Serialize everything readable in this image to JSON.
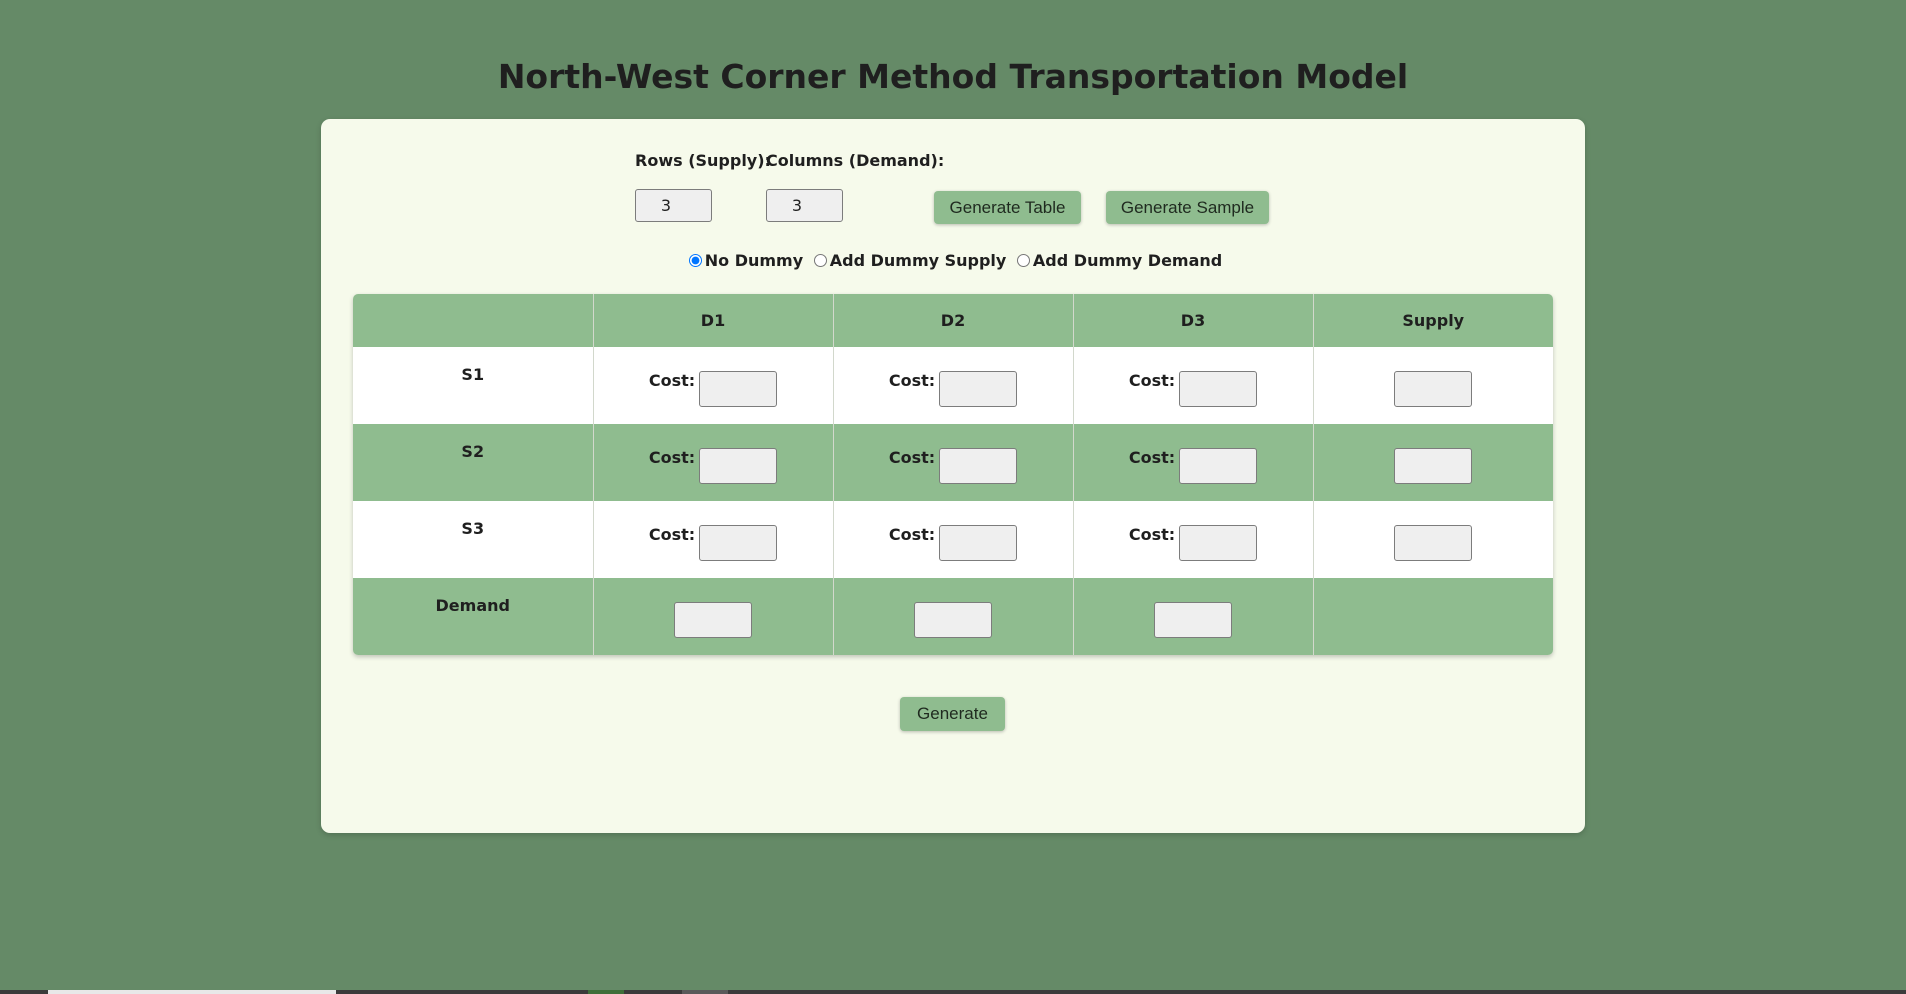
{
  "page": {
    "title": "North-West Corner Method Transportation Model"
  },
  "controls": {
    "rows_label": "Rows (Supply):",
    "rows_value": "3",
    "cols_label": "Columns (Demand):",
    "cols_value": "3",
    "generate_table_label": "Generate Table",
    "generate_sample_label": "Generate Sample"
  },
  "dummy_options": {
    "selected": "no-dummy",
    "options": [
      {
        "id": "no-dummy",
        "label": "No Dummy",
        "checked": true
      },
      {
        "id": "add-dummy-supply",
        "label": "Add Dummy Supply",
        "checked": false
      },
      {
        "id": "add-dummy-demand",
        "label": "Add Dummy Demand",
        "checked": false
      }
    ]
  },
  "table": {
    "corner": "",
    "headers": [
      "D1",
      "D2",
      "D3",
      "Supply"
    ],
    "cost_label": "Cost:",
    "rows": [
      {
        "label": "S1",
        "costs": [
          "",
          "",
          ""
        ],
        "supply": ""
      },
      {
        "label": "S2",
        "costs": [
          "",
          "",
          ""
        ],
        "supply": ""
      },
      {
        "label": "S3",
        "costs": [
          "",
          "",
          ""
        ],
        "supply": ""
      }
    ],
    "demand_row": {
      "label": "Demand",
      "values": [
        "",
        "",
        ""
      ]
    }
  },
  "actions": {
    "generate_label": "Generate"
  },
  "colors": {
    "background": "#658a67",
    "card": "#f6faeb",
    "accent": "#8fbc8f"
  }
}
